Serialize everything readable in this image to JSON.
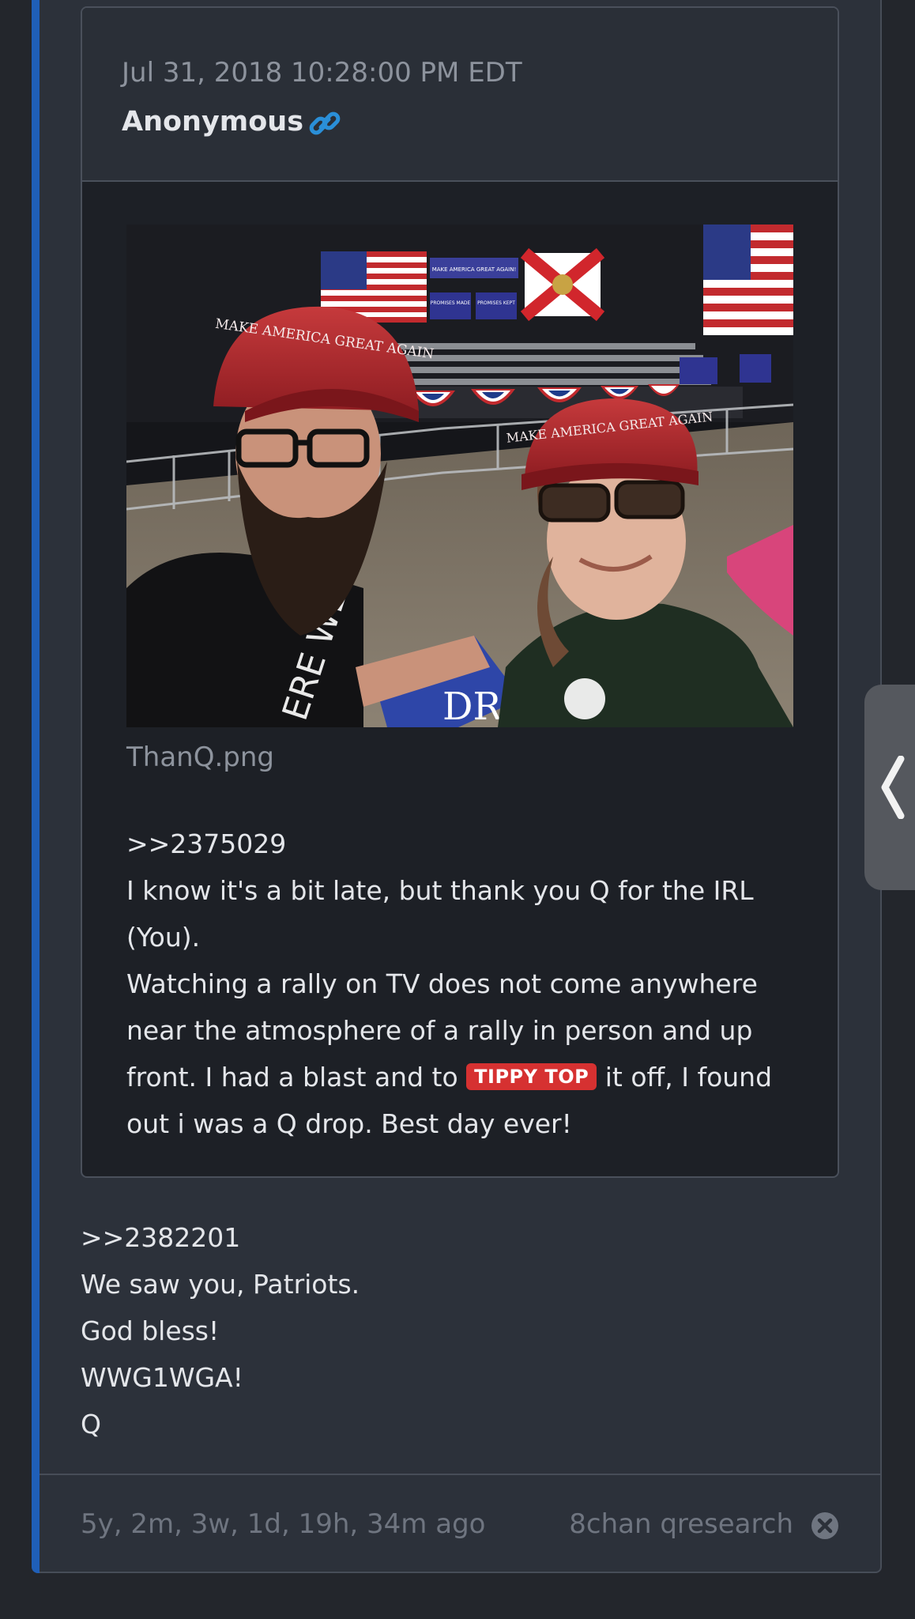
{
  "quoted_post": {
    "date": "Jul 31, 2018 10:28:00 PM EDT",
    "author": "Anonymous",
    "image_filename": "ThanQ.png",
    "reply_ref": ">>2375029",
    "line1": "I know it's a bit late, but thank you Q for the IRL (You).",
    "line2_before": "Watching a rally on TV does not come anywhere near the atmosphere of a rally in person and up front. I had a blast and to",
    "tag": "TIPPY TOP",
    "line2_after": "it off, I found out i was a Q drop. Best day ever!",
    "photo_signs": {
      "hat_left": "MAKE AMERICA GREAT AGAIN",
      "hat_right": "MAKE AMERICA GREAT AGAIN",
      "banner": "MAKE AMERICA GREAT AGAIN!",
      "sign_promises_made": "PROMISES MADE",
      "sign_promises_kept": "PROMISES KEPT",
      "held_sign": "DR",
      "shirt_text": "ERE WE"
    }
  },
  "post": {
    "reply_ref": ">>2382201",
    "lines": [
      "We saw you, Patriots.",
      "God bless!",
      "WWG1WGA!",
      "Q"
    ]
  },
  "footer": {
    "time_ago": "5y, 2m, 3w, 1d, 19h, 34m ago",
    "source": "8chan qresearch"
  },
  "icons": {
    "link": "link-icon",
    "close": "close-circle-icon",
    "drawer": "chevron-left-icon"
  },
  "colors": {
    "accent": "#1f5fb8",
    "link": "#2a8fd8",
    "tag": "#d63131",
    "background": "#23262c",
    "card": "#2c313a"
  }
}
